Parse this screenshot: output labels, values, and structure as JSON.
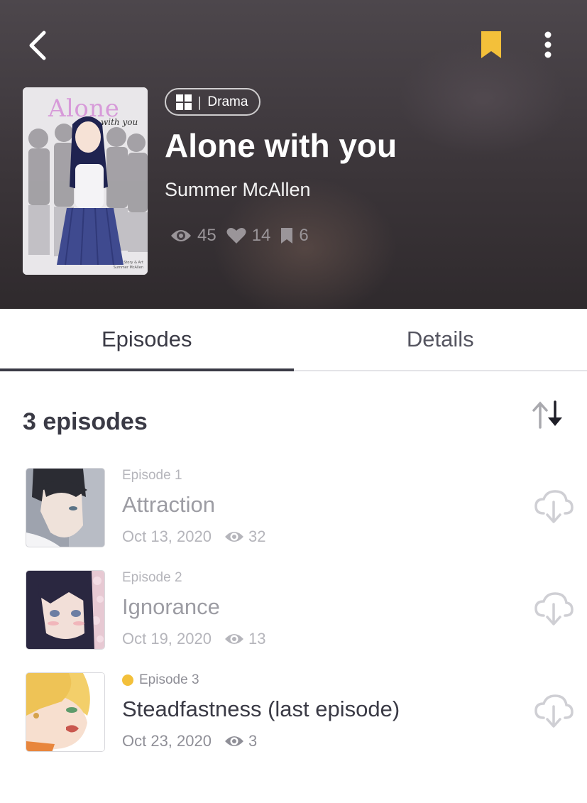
{
  "header": {
    "genre": "Drama",
    "genre_separator": "|",
    "title": "Alone with you",
    "author": "Summer McAllen",
    "stats": {
      "views": "45",
      "likes": "14",
      "bookmarks": "6"
    },
    "accent_color": "#f3c03a",
    "cover": {
      "title": "Alone",
      "subtitle": "with you",
      "credit_line1": "Story & Art",
      "credit_line2": "Summer McAllen"
    }
  },
  "tabs": [
    {
      "label": "Episodes",
      "active": true
    },
    {
      "label": "Details",
      "active": false
    }
  ],
  "episodes_section": {
    "count_label": "3 episodes",
    "items": [
      {
        "number": "Episode 1",
        "title": "Attraction",
        "date": "Oct 13, 2020",
        "views": "32",
        "read": true
      },
      {
        "number": "Episode 2",
        "title": "Ignorance",
        "date": "Oct 19, 2020",
        "views": "13",
        "read": true
      },
      {
        "number": "Episode 3",
        "title": "Steadfastness (last episode)",
        "date": "Oct 23, 2020",
        "views": "3",
        "read": false
      }
    ]
  },
  "icons": {
    "back": "chevron-left-icon",
    "bookmark": "bookmark-icon",
    "more": "more-vertical-icon",
    "genre": "grid-icon",
    "views": "eye-icon",
    "likes": "heart-icon",
    "bookmarks": "bookmark-icon",
    "sort": "sort-arrows-icon",
    "download": "cloud-download-icon"
  }
}
